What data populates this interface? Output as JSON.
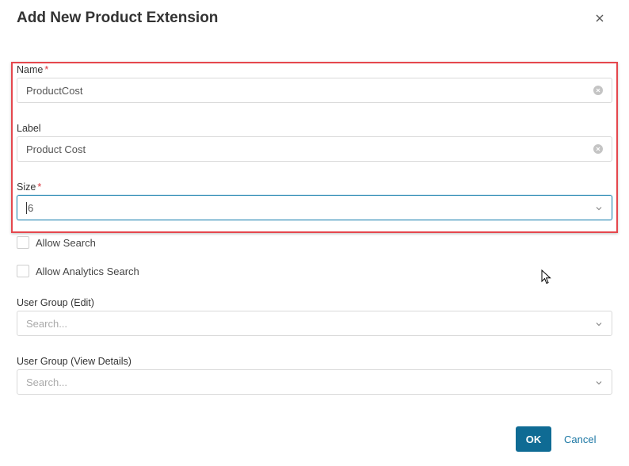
{
  "dialog": {
    "title": "Add New Product Extension",
    "close_icon": "close-icon"
  },
  "form": {
    "name": {
      "label": "Name",
      "required": "*",
      "value": "ProductCost"
    },
    "label_field": {
      "label": "Label",
      "value": "Product Cost"
    },
    "size": {
      "label": "Size",
      "required": "*",
      "value": "6"
    },
    "allow_search": {
      "label": "Allow Search",
      "checked": false
    },
    "allow_analytics_search": {
      "label": "Allow Analytics Search",
      "checked": false
    },
    "user_group_edit": {
      "label": "User Group (Edit)",
      "placeholder": "Search..."
    },
    "user_group_view": {
      "label": "User Group (View Details)",
      "placeholder": "Search..."
    }
  },
  "footer": {
    "ok_label": "OK",
    "cancel_label": "Cancel"
  },
  "colors": {
    "primary": "#0f6b94",
    "link": "#1a76a3",
    "required": "#d9363e",
    "highlight": "#e5474d",
    "focus_border": "#2e8bb5"
  }
}
